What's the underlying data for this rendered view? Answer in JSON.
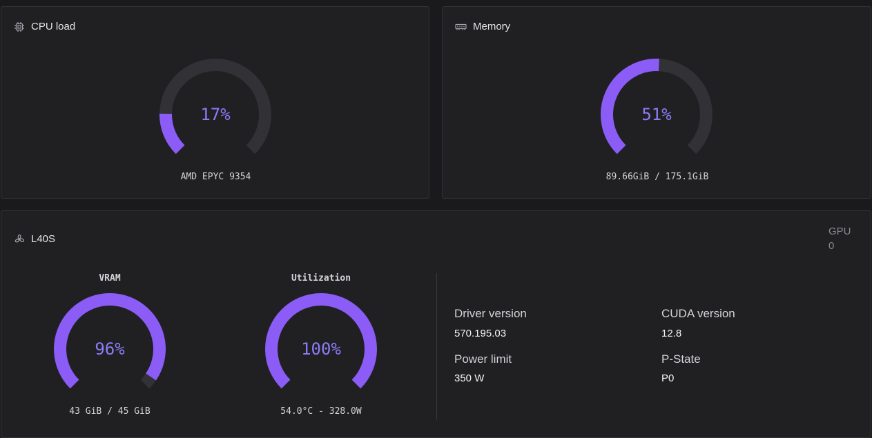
{
  "cpu": {
    "title": "CPU load",
    "icon": "cpu-chip-icon",
    "percent_label": "17%",
    "percent": 17,
    "caption": "AMD EPYC 9354"
  },
  "memory": {
    "title": "Memory",
    "icon": "memory-module-icon",
    "percent_label": "51%",
    "percent": 51,
    "caption": "89.66GiB / 175.1GiB"
  },
  "gpu": {
    "title": "L40S",
    "icon": "gpu-fan-icon",
    "index_label": "GPU",
    "index_value": "0",
    "vram": {
      "title": "VRAM",
      "percent_label": "96%",
      "percent": 96,
      "caption": "43 GiB / 45 GiB"
    },
    "utilization": {
      "title": "Utilization",
      "percent_label": "100%",
      "percent": 100,
      "caption": "54.0°C - 328.0W"
    },
    "info": {
      "driver_version_label": "Driver version",
      "driver_version": "570.195.03",
      "cuda_version_label": "CUDA version",
      "cuda_version": "12.8",
      "power_limit_label": "Power limit",
      "power_limit": "350 W",
      "pstate_label": "P-State",
      "pstate": "P0"
    }
  },
  "colors": {
    "accent": "#8b5cf6",
    "track": "#313136",
    "card_bg": "#202023",
    "page_bg": "#1a1a1d"
  }
}
